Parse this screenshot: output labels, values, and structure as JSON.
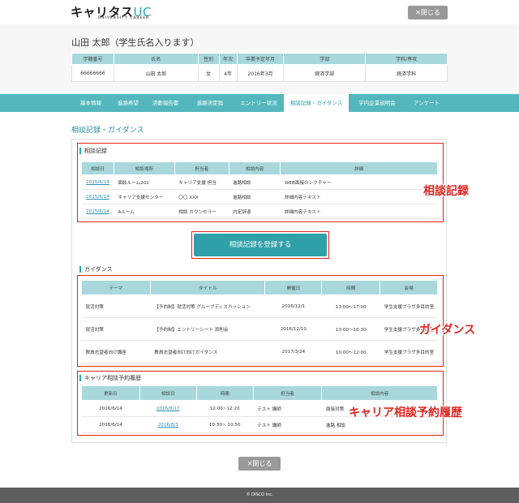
{
  "header": {
    "logo_main": "キャリタス",
    "logo_uc": "UC",
    "logo_sub": "UNIVERSITY CAREER",
    "close_label": "✕閉じる"
  },
  "student": {
    "name": "山田 太郎（学生氏名入ります）",
    "columns": [
      "学籍番号",
      "氏名",
      "性別",
      "年次",
      "卒業予定年月",
      "学部",
      "学科/専攻"
    ],
    "values": [
      "66666666",
      "山田 太郎",
      "女",
      "4年",
      "2016年3月",
      "経済学部",
      "経済学科"
    ]
  },
  "nav": {
    "tabs": [
      "基本情報",
      "進路希望",
      "活動報告書",
      "進路決定届",
      "エントリー状況",
      "相談記録・ガイダンス",
      "学内企業説明会",
      "アンケート"
    ]
  },
  "page": {
    "title": "相談記録・ガイダンス"
  },
  "consult": {
    "label": "相談記録",
    "columns": [
      "相談日",
      "相談場所",
      "担当者",
      "相談内容",
      "詳細"
    ],
    "rows": [
      [
        "2015/6/14",
        "面談ルーム202",
        "キャリア支援 担当",
        "進路相談",
        "WEB面接のレクチャー"
      ],
      [
        "2015/6/14",
        "キャリア支援センター",
        "〇〇 XXX",
        "進路相談",
        "詳細内容テキスト"
      ],
      [
        "2015/6/14",
        "Aルーム",
        "相談 カウンセラー",
        "内定辞退",
        "詳細内容テキスト"
      ]
    ],
    "register_label": "相談記録を登録する"
  },
  "guidance": {
    "label": "ガイダンス",
    "columns": [
      "テーマ",
      "タイトル",
      "開催日",
      "時間",
      "会場"
    ],
    "rows": [
      [
        "就活対策",
        "【予約制】就活対策 グループディスカッション",
        "2016/12/1",
        "13:00～17:00",
        "学生支援プラザ多目的室"
      ],
      [
        "就活対策",
        "【予約制】エントリーシート 添削会",
        "2016/12/10",
        "13:00～16:30",
        "学生支援プラザ多目的室"
      ],
      [
        "教員志望者向け講座",
        "教員志望者向け向けガイダンス",
        "2017/3/24",
        "10:00～12:00",
        "学生支援プラザ多目的室"
      ]
    ]
  },
  "career": {
    "label": "キャリア相談予約履歴",
    "columns": [
      "更新日",
      "相談日",
      "時間",
      "担当者",
      "相談内容"
    ],
    "rows": [
      [
        "2016/6/14",
        "2016/8/17",
        "12:00~12:20",
        "テスト 講師",
        "面接対策"
      ],
      [
        "2016/6/14",
        "2016/8/3",
        "10:30~ 10:50",
        "テスト 講師",
        "進路 相談"
      ]
    ]
  },
  "annotations": {
    "consult": "相談記録",
    "guidance": "ガイダンス",
    "career": "キャリア相談予約履歴"
  },
  "footer": {
    "copyright": "© DISCO Inc."
  },
  "colors": {
    "accent": "#53b7bd",
    "header_cell": "#a8d8dc",
    "annotation": "#e0241e"
  }
}
